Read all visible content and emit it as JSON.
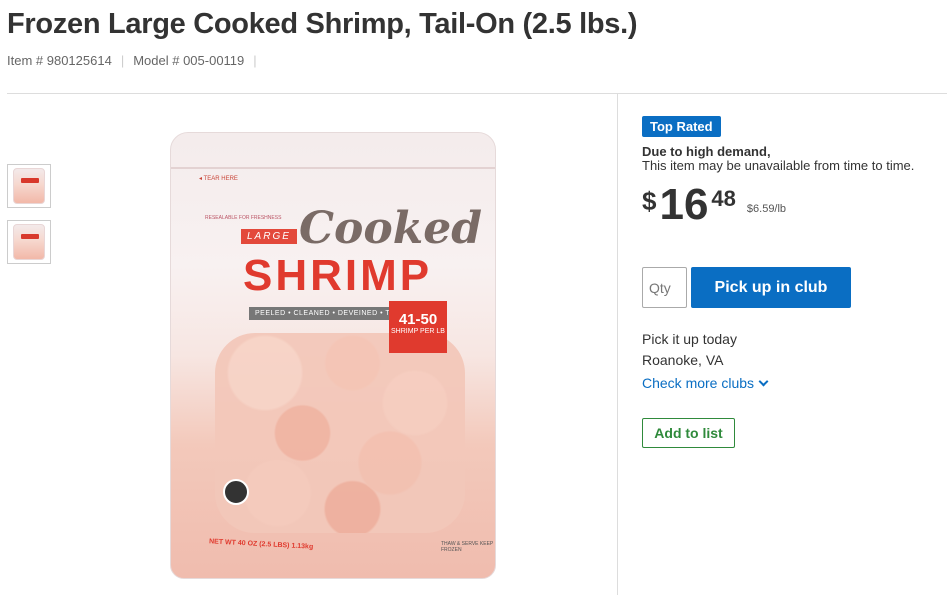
{
  "product": {
    "title": "Frozen Large Cooked Shrimp, Tail-On (2.5 lbs.)",
    "item_number": "Item # 980125614",
    "model_number": "Model # 005-00119",
    "separator": "|"
  },
  "thumbnails": [
    {
      "label": "thumbnail-1"
    },
    {
      "label": "thumbnail-2"
    }
  ],
  "packaging": {
    "tear_here": "◂ TEAR HERE",
    "resealable": "RESEALABLE FOR FRESHNESS",
    "large": "LARGE",
    "cooked": "Cooked",
    "shrimp": "SHRIMP",
    "prep": "PEELED • CLEANED • DEVEINED • TAIL-ON",
    "count": "41-50",
    "count_sub": "SHRIMP PER LB",
    "net_weight": "NET WT 40 OZ (2.5 LBS) 1.13kg",
    "thaw": "THAW & SERVE KEEP FROZEN"
  },
  "badge": "Top Rated",
  "availability": {
    "title": "Due to high demand,",
    "text": "This item may be unavailable from time to time."
  },
  "price": {
    "currency": "$",
    "dollars": "16",
    "cents": "48",
    "unit_price": "$6.59/lb"
  },
  "purchase": {
    "qty_placeholder": "Qty",
    "pickup_button": "Pick up in club"
  },
  "club": {
    "pick_up_today": "Pick it up today",
    "location": "Roanoke, VA",
    "check_more": "Check more clubs"
  },
  "add_to_list": "Add to list",
  "colors": {
    "accent_blue": "#0a6ec3",
    "list_green": "#2f8a3b",
    "brand_red": "#e03a2e"
  }
}
